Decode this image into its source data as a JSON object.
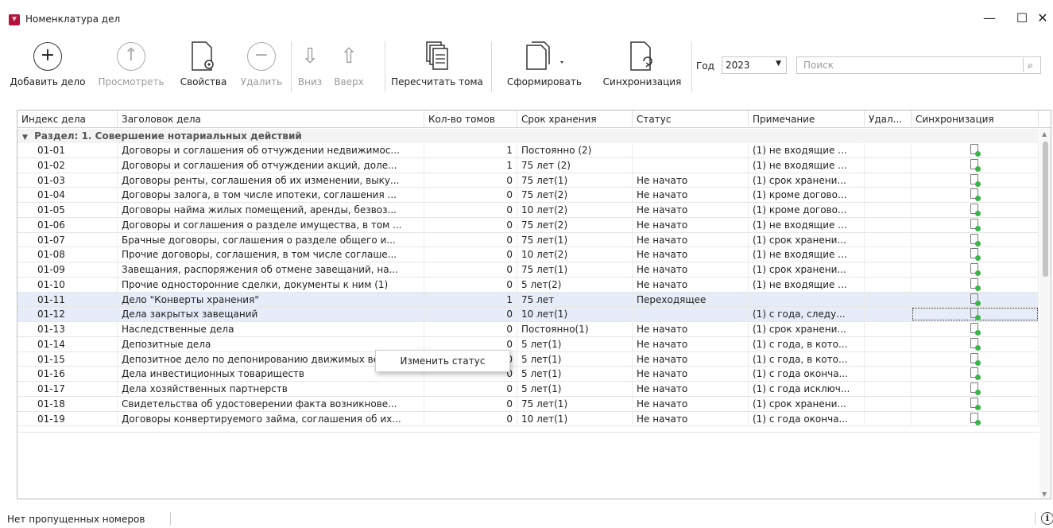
{
  "window": {
    "title": "Номенклатура дел",
    "controls": {
      "minimize": "—",
      "maximize": "☐",
      "close": "✕"
    }
  },
  "toolbar": {
    "buttons": [
      {
        "label": "Добавить дело",
        "icon": "plus-circle-icon",
        "enabled": true
      },
      {
        "label": "Просмотреть",
        "icon": "arrow-up-circle-icon",
        "enabled": false
      },
      {
        "label": "Свойства",
        "icon": "document-gear-icon",
        "enabled": true
      },
      {
        "label": "Удалить",
        "icon": "minus-circle-icon",
        "enabled": false
      },
      {
        "label": "Вниз",
        "icon": "arrow-down-icon",
        "enabled": false
      },
      {
        "label": "Вверх",
        "icon": "arrow-up-icon",
        "enabled": false
      },
      {
        "label": "Пересчитать тома",
        "icon": "documents-stack-icon",
        "enabled": true
      },
      {
        "label": "Сформировать",
        "icon": "documents-copy-icon",
        "enabled": true
      },
      {
        "label": "Синхронизация",
        "icon": "document-sync-icon",
        "enabled": true
      }
    ],
    "year_label": "Год",
    "year_value": "2023",
    "search_placeholder": "Поиск"
  },
  "grid": {
    "columns": [
      "Индекс дела",
      "Заголовок дела",
      "Кол-во томов",
      "Срок хранения",
      "Статус",
      "Примечание",
      "Удал...",
      "Синхронизация"
    ],
    "group_label": "Раздел: 1. Совершение нотариальных действий",
    "rows": [
      {
        "index": "01-01",
        "title": "Договоры и соглашения об отчуждении недвижимос...",
        "volumes": "1",
        "retention": "Постоянно (2)",
        "status": "",
        "note": "(1) не входящие ..."
      },
      {
        "index": "01-02",
        "title": "Договоры и соглашения об отчуждении акций, доле...",
        "volumes": "1",
        "retention": "75 лет (2)",
        "status": "",
        "note": "(1) не входящие ..."
      },
      {
        "index": "01-03",
        "title": "Договоры ренты, соглашения об их изменении, выку...",
        "volumes": "0",
        "retention": "75 лет(1)",
        "status": "Не начато",
        "note": "(1) срок хранени..."
      },
      {
        "index": "01-04",
        "title": "Договоры залога, в том числе ипотеки, соглашения ...",
        "volumes": "0",
        "retention": "75 лет(2)",
        "status": "Не начато",
        "note": "(1) кроме догово..."
      },
      {
        "index": "01-05",
        "title": "Договоры найма жилых помещений, аренды, безвоз...",
        "volumes": "0",
        "retention": "10 лет(2)",
        "status": "Не начато",
        "note": "(1) кроме догово..."
      },
      {
        "index": "01-06",
        "title": "Договоры и соглашения о разделе имущества, в том ...",
        "volumes": "0",
        "retention": "75 лет(2)",
        "status": "Не начато",
        "note": "(1) не входящие ..."
      },
      {
        "index": "01-07",
        "title": "Брачные договоры, соглашения о разделе общего и...",
        "volumes": "0",
        "retention": "75 лет(1)",
        "status": "Не начато",
        "note": "(1) срок хранени..."
      },
      {
        "index": "01-08",
        "title": "Прочие договоры, соглашения, в том числе соглаше...",
        "volumes": "0",
        "retention": "10 лет(2)",
        "status": "Не начато",
        "note": "(1) не входящие ..."
      },
      {
        "index": "01-09",
        "title": "Завещания, распоряжения об отмене завещаний, на...",
        "volumes": "0",
        "retention": "75 лет(1)",
        "status": "Не начато",
        "note": "(1) срок хранени..."
      },
      {
        "index": "01-10",
        "title": "Прочие односторонние сделки, документы к ним (1)",
        "volumes": "0",
        "retention": "5 лет(2)",
        "status": "Не начато",
        "note": "(1) не входящие ..."
      },
      {
        "index": "01-11",
        "title": "Дело \"Конверты хранения\"",
        "volumes": "1",
        "retention": "75 лет",
        "status": "Переходящее",
        "note": ""
      },
      {
        "index": "01-12",
        "title": "Дела закрытых завещаний",
        "volumes": "0",
        "retention": "10 лет(1)",
        "status": "",
        "note": "(1) с года, следу..."
      },
      {
        "index": "01-13",
        "title": "Наследственные дела",
        "volumes": "0",
        "retention": "Постоянно(1)",
        "status": "Не начато",
        "note": "(1) срок хранени..."
      },
      {
        "index": "01-14",
        "title": "Депозитные дела",
        "volumes": "0",
        "retention": "5 лет(1)",
        "status": "Не начато",
        "note": "(1) с года, в кото..."
      },
      {
        "index": "01-15",
        "title": "Депозитное дело по депонированию движимых вещ...",
        "volumes": "0",
        "retention": "5 лет(1)",
        "status": "Не начато",
        "note": "(1) с года, в кото..."
      },
      {
        "index": "01-16",
        "title": "Дела инвестиционных товариществ",
        "volumes": "0",
        "retention": "5 лет(1)",
        "status": "Не начато",
        "note": "(1) с года оконча..."
      },
      {
        "index": "01-17",
        "title": "Дела хозяйственных партнерств",
        "volumes": "0",
        "retention": "5 лет(1)",
        "status": "Не начато",
        "note": "(1) с года исключ..."
      },
      {
        "index": "01-18",
        "title": "Свидетельства об удостоверении факта возникнове...",
        "volumes": "0",
        "retention": "75 лет(1)",
        "status": "Не начато",
        "note": "(1) срок хранени..."
      },
      {
        "index": "01-19",
        "title": "Договоры конвертируемого займа, соглашения об их...",
        "volumes": "0",
        "retention": "10 лет(1)",
        "status": "Не начато",
        "note": "(1) с года оконча..."
      }
    ]
  },
  "context_menu": {
    "item": "Изменить статус"
  },
  "statusbar": {
    "text": "Нет пропущенных номеров",
    "info_icon": "info-icon"
  },
  "colors": {
    "selected_row": "#e6edf8",
    "sync_dot": "#39b54a",
    "app_icon": "#b3133b"
  }
}
